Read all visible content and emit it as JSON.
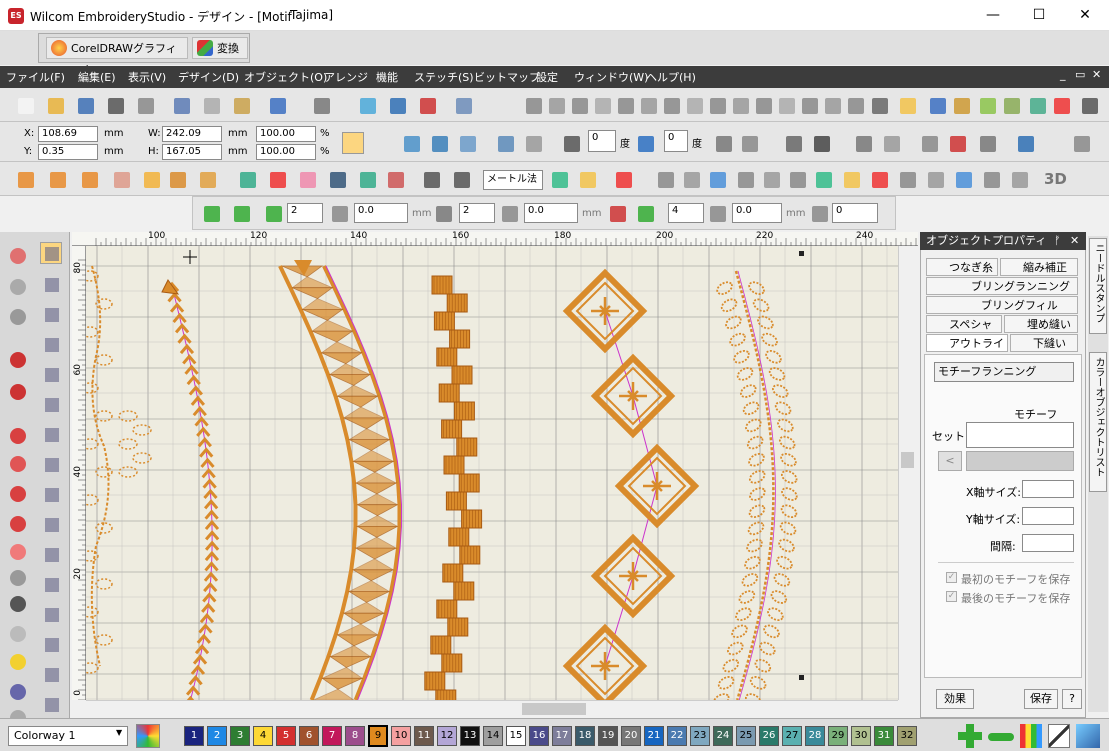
{
  "window": {
    "app_icon_text": "ES",
    "title": "Wilcom EmbroideryStudio - デザイン - [Motif",
    "title_extra": "Tajima]",
    "minimize": "—",
    "maximize": "☐",
    "close": "✕"
  },
  "coreldraw_bar": {
    "coreldraw_label": "CorelDRAWグラフィック",
    "convert_label": "変換"
  },
  "menu": [
    "ファイル(F)",
    "編集(E)",
    "表示(V)",
    "デザイン(D)",
    "オブジェクト(O)",
    "アレンジ",
    "機能",
    "ステッチ(S)",
    "ビットマップ",
    "設定",
    "ウィンドウ(W)",
    "ヘルプ(H)"
  ],
  "mdi_controls": [
    "_",
    "▭",
    "✕"
  ],
  "props": {
    "x_label": "X:",
    "x_value": "108.69",
    "x_unit": "mm",
    "y_label": "Y:",
    "y_value": "0.35",
    "y_unit": "mm",
    "w_label": "W:",
    "w_value": "242.09",
    "w_unit": "mm",
    "h_label": "H:",
    "h_value": "167.05",
    "h_unit": "mm",
    "sx_value": "100.00",
    "sx_unit": "%",
    "sy_value": "100.00",
    "sy_unit": "%",
    "rotate_value": "0",
    "rotate_unit": "度",
    "slant_value": "0",
    "slant_unit": "度"
  },
  "tools_row": {
    "method_select": "メートル法"
  },
  "spacing_row": {
    "v1": "2",
    "v2": "0.0",
    "unit1": "mm",
    "v3": "2",
    "v4": "0.0",
    "unit2": "mm",
    "v5": "4",
    "v6": "0.0",
    "unit3": "mm",
    "v7": "0",
    "threeD": "3D"
  },
  "ruler": {
    "top_ticks": [
      "100",
      "120",
      "140",
      "160",
      "180",
      "200",
      "220",
      "240"
    ],
    "left_ticks": [
      "80",
      "60",
      "40",
      "20",
      "0"
    ]
  },
  "panel": {
    "title": "オブジェクトプロパティ",
    "pin": "ᚠ",
    "close": "✕",
    "tabs": {
      "tsunagi": "つなぎ糸",
      "chijimi": "縮み補正",
      "bling_run": "ブリングランニング",
      "bling_fill": "ブリングフィル",
      "special": "スペシャル",
      "fill_stitch": "埋め縫い",
      "outline": "アウトライン",
      "underlay": "下縫い"
    },
    "type_value": "モチーフランニング",
    "motif_heading": "モチーフ",
    "set_label": "セット:",
    "prev_btn": "<",
    "x_size_label": "X軸サイズ:",
    "y_size_label": "Y軸サイズ:",
    "gap_label": "間隔:",
    "keep_first": "最初のモチーフを保存",
    "keep_last": "最後のモチーフを保存",
    "effect_btn": "効果",
    "save_btn": "保存",
    "help_btn": "?"
  },
  "side_tabs": [
    "ニードルスタンプ",
    "カラーオブジェクトリスト"
  ],
  "bottom": {
    "colorway": "Colorway 1",
    "swatches": [
      {
        "n": "1",
        "c": "#1a237e",
        "t": "#fff"
      },
      {
        "n": "2",
        "c": "#1e88e5",
        "t": "#fff"
      },
      {
        "n": "3",
        "c": "#2e7d32",
        "t": "#fff"
      },
      {
        "n": "4",
        "c": "#fdd835",
        "t": "#000"
      },
      {
        "n": "5",
        "c": "#d32f2f",
        "t": "#fff"
      },
      {
        "n": "6",
        "c": "#a0522d",
        "t": "#fff"
      },
      {
        "n": "7",
        "c": "#c2185b",
        "t": "#fff"
      },
      {
        "n": "8",
        "c": "#9c4d8c",
        "t": "#fff"
      },
      {
        "n": "9",
        "c": "#e08a1e",
        "t": "#000"
      },
      {
        "n": "10",
        "c": "#f4a0a0",
        "t": "#000"
      },
      {
        "n": "11",
        "c": "#6d5a4d",
        "t": "#fff"
      },
      {
        "n": "12",
        "c": "#b3a6d6",
        "t": "#000"
      },
      {
        "n": "13",
        "c": "#111111",
        "t": "#fff"
      },
      {
        "n": "14",
        "c": "#9e9e9e",
        "t": "#000"
      },
      {
        "n": "15",
        "c": "#ffffff",
        "t": "#000"
      },
      {
        "n": "16",
        "c": "#4a4a8a",
        "t": "#fff"
      },
      {
        "n": "17",
        "c": "#7d7d9a",
        "t": "#fff"
      },
      {
        "n": "18",
        "c": "#3a5a6a",
        "t": "#fff"
      },
      {
        "n": "19",
        "c": "#555555",
        "t": "#fff"
      },
      {
        "n": "20",
        "c": "#777777",
        "t": "#fff"
      },
      {
        "n": "21",
        "c": "#1565c0",
        "t": "#fff"
      },
      {
        "n": "22",
        "c": "#4a7ab0",
        "t": "#fff"
      },
      {
        "n": "23",
        "c": "#7fa8c0",
        "t": "#000"
      },
      {
        "n": "24",
        "c": "#3e6a5a",
        "t": "#fff"
      },
      {
        "n": "25",
        "c": "#7a9ab0",
        "t": "#000"
      },
      {
        "n": "26",
        "c": "#2a7a6a",
        "t": "#fff"
      },
      {
        "n": "27",
        "c": "#5ab0b0",
        "t": "#000"
      },
      {
        "n": "28",
        "c": "#3a8a9a",
        "t": "#fff"
      },
      {
        "n": "29",
        "c": "#7ab07a",
        "t": "#000"
      },
      {
        "n": "30",
        "c": "#b0c090",
        "t": "#000"
      },
      {
        "n": "31",
        "c": "#3a8a3a",
        "t": "#fff"
      },
      {
        "n": "32",
        "c": "#a0a070",
        "t": "#000"
      }
    ]
  },
  "colors": {
    "stitch": "#d98b2b",
    "stitch_dark": "#a85a12",
    "selection": "#cc33cc",
    "menubar": "#3c3c3c"
  }
}
